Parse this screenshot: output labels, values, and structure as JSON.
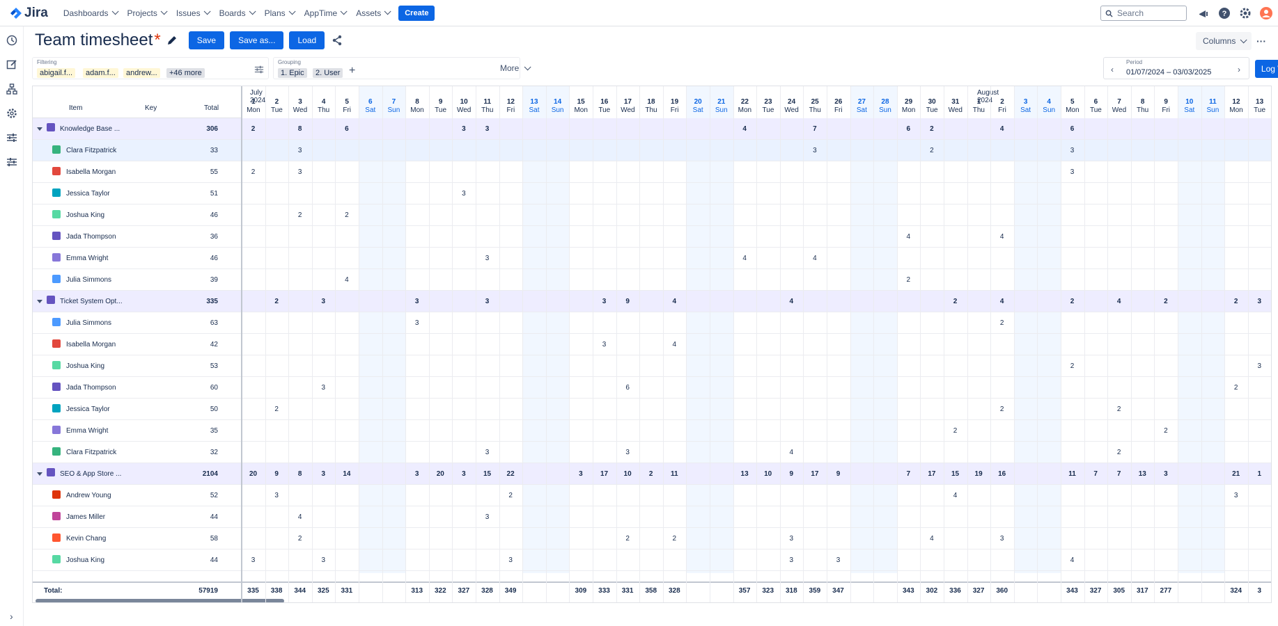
{
  "brand": {
    "name": "Jira"
  },
  "nav": [
    "Dashboards",
    "Projects",
    "Issues",
    "Boards",
    "Plans",
    "AppTime",
    "Assets"
  ],
  "create_label": "Create",
  "search_placeholder": "Search",
  "rail_icons": [
    "clock-icon",
    "edit-icon",
    "hierarchy-icon",
    "settings-icon",
    "sliders-icon",
    "sliders-icon",
    "expand-icon"
  ],
  "title": "Team timesheet",
  "dirty_marker": "*",
  "actions": {
    "save": "Save",
    "save_as": "Save as...",
    "load": "Load"
  },
  "columns_label": "Columns",
  "filtering": {
    "label": "Filtering",
    "chips": [
      "abigail.f...",
      "adam.f...",
      "andrew...",
      "+46 more"
    ]
  },
  "grouping": {
    "label": "Grouping",
    "chips": [
      "1. Epic",
      "2. User"
    ]
  },
  "more_label": "More",
  "period": {
    "label": "Period",
    "value": "01/07/2024 – 03/03/2025"
  },
  "log_work": "Log Work",
  "headers": {
    "item": "Item",
    "key": "Key",
    "total": "Total"
  },
  "months": [
    "July 2024",
    "August 2024"
  ],
  "days": [
    [
      "1",
      "Mon"
    ],
    [
      "2",
      "Tue"
    ],
    [
      "3",
      "Wed"
    ],
    [
      "4",
      "Thu"
    ],
    [
      "5",
      "Fri"
    ],
    [
      "6",
      "Sat"
    ],
    [
      "7",
      "Sun"
    ],
    [
      "8",
      "Mon"
    ],
    [
      "9",
      "Tue"
    ],
    [
      "10",
      "Wed"
    ],
    [
      "11",
      "Thu"
    ],
    [
      "12",
      "Fri"
    ],
    [
      "13",
      "Sat"
    ],
    [
      "14",
      "Sun"
    ],
    [
      "15",
      "Mon"
    ],
    [
      "16",
      "Tue"
    ],
    [
      "17",
      "Wed"
    ],
    [
      "18",
      "Thu"
    ],
    [
      "19",
      "Fri"
    ],
    [
      "20",
      "Sat"
    ],
    [
      "21",
      "Sun"
    ],
    [
      "22",
      "Mon"
    ],
    [
      "23",
      "Tue"
    ],
    [
      "24",
      "Wed"
    ],
    [
      "25",
      "Thu"
    ],
    [
      "26",
      "Fri"
    ],
    [
      "27",
      "Sat"
    ],
    [
      "28",
      "Sun"
    ],
    [
      "29",
      "Mon"
    ],
    [
      "30",
      "Tue"
    ],
    [
      "31",
      "Wed"
    ],
    [
      "1",
      "Thu"
    ],
    [
      "2",
      "Fri"
    ],
    [
      "3",
      "Sat"
    ],
    [
      "4",
      "Sun"
    ],
    [
      "5",
      "Mon"
    ],
    [
      "6",
      "Tue"
    ],
    [
      "7",
      "Wed"
    ],
    [
      "8",
      "Thu"
    ],
    [
      "9",
      "Fri"
    ],
    [
      "10",
      "Sat"
    ],
    [
      "11",
      "Sun"
    ],
    [
      "12",
      "Mon"
    ],
    [
      "13",
      "Tue"
    ]
  ],
  "rows": [
    {
      "type": "group",
      "name": "Knowledge Base ...",
      "total": "306",
      "cells": {
        "0": "2",
        "2": "8",
        "4": "6",
        "9": "3",
        "10": "3",
        "21": "4",
        "24": "7",
        "28": "6",
        "29": "2",
        "32": "4",
        "35": "6"
      }
    },
    {
      "type": "user",
      "name": "Clara Fitzpatrick",
      "total": "33",
      "color": "#36b37e",
      "cells": {
        "2": "3",
        "24": "3",
        "29": "2",
        "35": "3"
      }
    },
    {
      "type": "user",
      "name": "Isabella Morgan",
      "total": "55",
      "color": "#e2483d",
      "cells": {
        "0": "2",
        "2": "3",
        "35": "3"
      }
    },
    {
      "type": "user",
      "name": "Jessica Taylor",
      "total": "51",
      "color": "#00a3bf",
      "cells": {
        "9": "3"
      }
    },
    {
      "type": "user",
      "name": "Joshua King",
      "total": "46",
      "color": "#57d9a3",
      "cells": {
        "2": "2",
        "4": "2"
      }
    },
    {
      "type": "user",
      "name": "Jada Thompson",
      "total": "36",
      "color": "#6554c0",
      "cells": {
        "28": "4",
        "32": "4"
      }
    },
    {
      "type": "user",
      "name": "Emma Wright",
      "total": "46",
      "color": "#8777d9",
      "cells": {
        "10": "3",
        "21": "4",
        "24": "4"
      }
    },
    {
      "type": "user",
      "name": "Julia Simmons",
      "total": "39",
      "color": "#4c9aff",
      "cells": {
        "4": "4",
        "28": "2"
      }
    },
    {
      "type": "group",
      "name": "Ticket System Opt...",
      "total": "335",
      "cells": {
        "1": "2",
        "3": "3",
        "7": "3",
        "10": "3",
        "15": "3",
        "16": "9",
        "18": "4",
        "23": "4",
        "30": "2",
        "32": "4",
        "35": "2",
        "37": "4",
        "39": "2",
        "42": "2",
        "43": "3"
      }
    },
    {
      "type": "user",
      "name": "Julia Simmons",
      "total": "63",
      "color": "#4c9aff",
      "cells": {
        "7": "3",
        "32": "2"
      }
    },
    {
      "type": "user",
      "name": "Isabella Morgan",
      "total": "42",
      "color": "#e2483d",
      "cells": {
        "15": "3",
        "18": "4"
      }
    },
    {
      "type": "user",
      "name": "Joshua King",
      "total": "53",
      "color": "#57d9a3",
      "cells": {
        "35": "2",
        "43": "3"
      }
    },
    {
      "type": "user",
      "name": "Jada Thompson",
      "total": "60",
      "color": "#6554c0",
      "cells": {
        "3": "3",
        "16": "6",
        "42": "2"
      }
    },
    {
      "type": "user",
      "name": "Jessica Taylor",
      "total": "50",
      "color": "#00a3bf",
      "cells": {
        "1": "2",
        "32": "2",
        "37": "2"
      }
    },
    {
      "type": "user",
      "name": "Emma Wright",
      "total": "35",
      "color": "#8777d9",
      "cells": {
        "30": "2",
        "39": "2"
      }
    },
    {
      "type": "user",
      "name": "Clara Fitzpatrick",
      "total": "32",
      "color": "#36b37e",
      "cells": {
        "10": "3",
        "16": "3",
        "23": "4",
        "37": "2"
      }
    },
    {
      "type": "group",
      "name": "SEO & App Store ...",
      "total": "2104",
      "cells": {
        "0": "20",
        "1": "9",
        "2": "8",
        "3": "3",
        "4": "14",
        "7": "3",
        "8": "20",
        "9": "3",
        "10": "15",
        "11": "22",
        "14": "3",
        "15": "17",
        "16": "10",
        "17": "2",
        "18": "11",
        "21": "13",
        "22": "10",
        "23": "9",
        "24": "17",
        "25": "9",
        "28": "7",
        "29": "17",
        "30": "15",
        "31": "19",
        "32": "16",
        "35": "11",
        "36": "7",
        "37": "7",
        "38": "13",
        "39": "3",
        "42": "21",
        "43": "1"
      }
    },
    {
      "type": "user",
      "name": "Andrew Young",
      "total": "52",
      "color": "#de350b",
      "cells": {
        "1": "3",
        "11": "2",
        "30": "4",
        "42": "3"
      }
    },
    {
      "type": "user",
      "name": "James Miller",
      "total": "44",
      "color": "#c0459a",
      "cells": {
        "2": "4",
        "10": "3"
      }
    },
    {
      "type": "user",
      "name": "Kevin Chang",
      "total": "58",
      "color": "#ff5630",
      "cells": {
        "2": "2",
        "16": "2",
        "18": "2",
        "23": "3",
        "29": "4",
        "32": "3"
      }
    },
    {
      "type": "user",
      "name": "Joshua King",
      "total": "44",
      "color": "#57d9a3",
      "cells": {
        "0": "3",
        "3": "3",
        "11": "3",
        "23": "3",
        "25": "3",
        "35": "4"
      }
    }
  ],
  "footer": {
    "label": "Total:",
    "total": "57919",
    "cells": {
      "0": "335",
      "1": "338",
      "2": "344",
      "3": "325",
      "4": "331",
      "7": "313",
      "8": "322",
      "9": "327",
      "10": "328",
      "11": "349",
      "14": "309",
      "15": "333",
      "16": "331",
      "17": "358",
      "18": "328",
      "21": "357",
      "22": "323",
      "23": "318",
      "24": "359",
      "25": "347",
      "28": "343",
      "29": "302",
      "30": "336",
      "31": "327",
      "32": "360",
      "35": "343",
      "36": "327",
      "37": "305",
      "38": "317",
      "39": "277",
      "42": "324",
      "43": "3"
    }
  }
}
